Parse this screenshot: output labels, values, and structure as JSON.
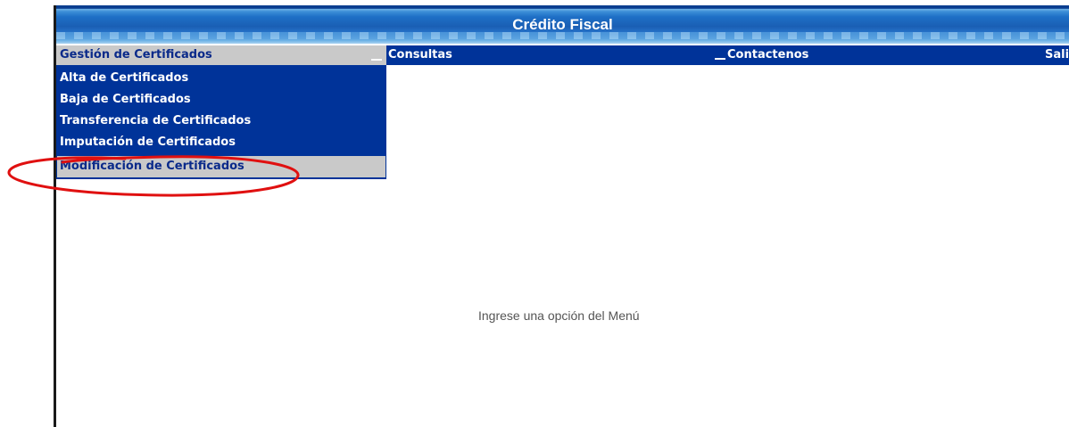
{
  "app": {
    "title": "Crédito Fiscal"
  },
  "menubar": {
    "items": [
      {
        "label": "Gestión de Certificados",
        "active": true
      },
      {
        "label": "Consultas"
      },
      {
        "label": "Contactenos"
      },
      {
        "label": "Sali"
      }
    ]
  },
  "dropdown": {
    "items": [
      {
        "label": "Alta de Certificados"
      },
      {
        "label": "Baja de Certificados"
      },
      {
        "label": "Transferencia de Certificados"
      },
      {
        "label": "Imputación de Certificados"
      },
      {
        "label": "Modificación de Certificados",
        "highlighted": true
      }
    ]
  },
  "main": {
    "message": "Ingrese una opción del Menú"
  },
  "colors": {
    "menu_bg": "#003399",
    "highlight_bg": "#c9c9c9",
    "annotation": "#e01010"
  }
}
